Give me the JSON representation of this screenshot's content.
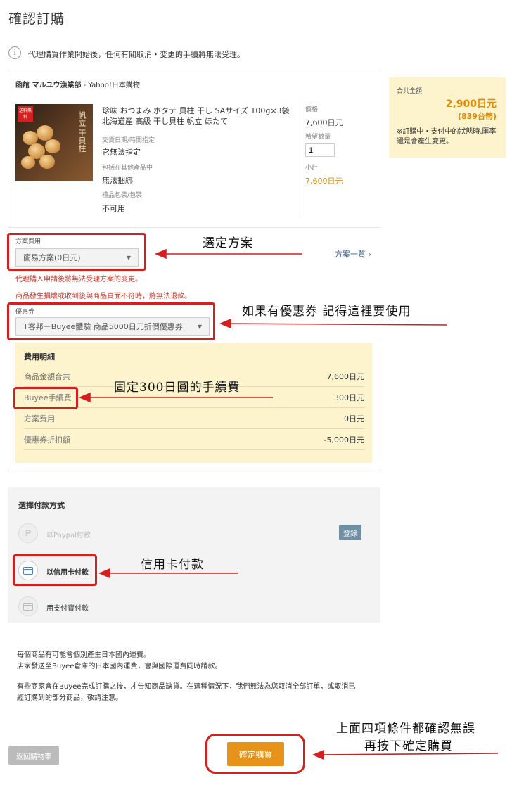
{
  "page_title": "確認訂購",
  "notice": "代理購買作業開始後，任何有關取消・変更的手續將無法受理。",
  "seller": {
    "name": "函館 マルユウ漁業部",
    "source": " - Yahoo!日本購物"
  },
  "product": {
    "image_tag": "送料無料",
    "image_text": "帆立 干貝柱",
    "name": "珍味 おつまみ ホタテ 貝柱 干し SAサイズ 100g×3袋 北海道産 高級 干し貝柱 帆立 ほたて",
    "delivery_label": "交貨日期/時間指定",
    "delivery_value": "它無法指定",
    "bundle_label": "包括在其他產品中",
    "bundle_value": "無法捆綁",
    "gift_label": "禮品包裝/包裝",
    "gift_value": "不可用",
    "price_label": "價格",
    "price_value": "7,600日元",
    "qty_label": "希望數量",
    "qty_value": "1",
    "subtotal_label": "小計",
    "subtotal_value": "7,600日元"
  },
  "plan": {
    "label": "方案費用",
    "selected": "簡易方案(0日元)",
    "list_link": "方案一覧 ›",
    "warning1": "代理購入申請後將無法受理方案的变更。",
    "warning2": "商品發生損壞或收到後與商品頁面不符時，將無法退款。"
  },
  "coupon": {
    "label": "優惠券",
    "selected": "T客邦－Buyee體驗 商品5000日元折價優惠券"
  },
  "fees": {
    "title": "費用明細",
    "rows": [
      {
        "label": "商品金額合共",
        "value": "7,600日元"
      },
      {
        "label": "Buyee手續費",
        "value": "300日元"
      },
      {
        "label": "方案費用",
        "value": "0日元"
      },
      {
        "label": "優惠券折扣額",
        "value": "-5,000日元"
      }
    ]
  },
  "summary": {
    "label": "合共金額",
    "amount": "2,900日元",
    "twd": "(839台幣)",
    "note": "※訂購中・支付中的狀態時,匯率還是會產生変更。"
  },
  "payment": {
    "title": "選擇付款方式",
    "paypal": "以Paypal付款",
    "login": "登錄",
    "card": "以信用卡付款",
    "other": "用支付寶付款"
  },
  "footer": {
    "line1": "每個商品有可能會個別產生日本國內運費。",
    "line2": "店家發送至Buyee倉庫的日本國內運費，會與國際運費同時請款。",
    "line3": "有些商家會在Buyee完成訂購之後，才告知商品缺貨。在這種情況下，我們無法為您取消全部訂單，或取消已",
    "line4": "經訂購到的部分商品，敬請注意。"
  },
  "buttons": {
    "back": "返回購物車",
    "confirm": "確定購買"
  },
  "annotations": {
    "plan": "選定方案",
    "coupon": "如果有優惠券 記得這裡要使用",
    "fee": "固定300日圓的手續費",
    "card": "信用卡付款",
    "final1": "上面四項條件都確認無誤",
    "final2": "再按下確定購買"
  },
  "colors": {
    "accent": "#e7931a",
    "highlight": "#d61e1e",
    "summary_bg": "#fdf3cc"
  }
}
